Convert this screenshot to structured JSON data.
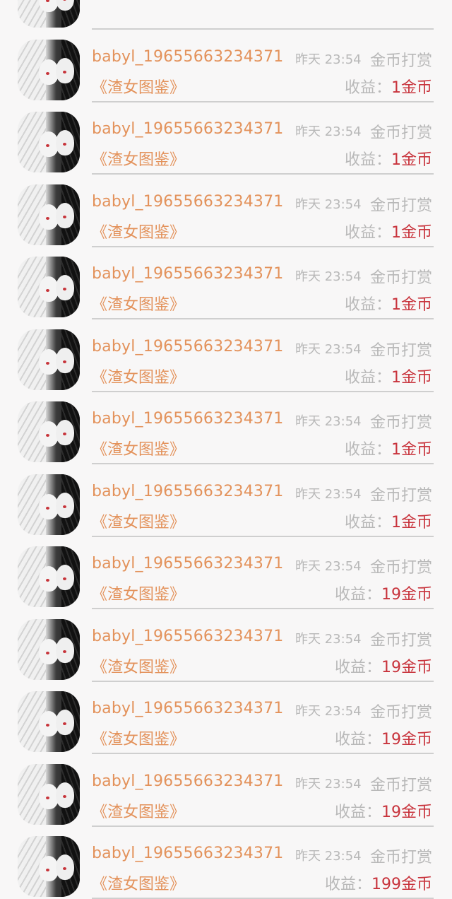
{
  "colors": {
    "accent_orange": "#e3925b",
    "muted_gray": "#b8b8b8",
    "amount_red": "#c8333c",
    "background": "#f8f7f7"
  },
  "records": [
    {
      "user": "babyl_19655663234371",
      "time": "昨天 23:54",
      "type": "金币打赏",
      "book": "《渣女图鉴》",
      "income_label": "收益：",
      "amount": "1金币"
    },
    {
      "user": "babyl_19655663234371",
      "time": "昨天 23:54",
      "type": "金币打赏",
      "book": "《渣女图鉴》",
      "income_label": "收益：",
      "amount": "1金币"
    },
    {
      "user": "babyl_19655663234371",
      "time": "昨天 23:54",
      "type": "金币打赏",
      "book": "《渣女图鉴》",
      "income_label": "收益：",
      "amount": "1金币"
    },
    {
      "user": "babyl_19655663234371",
      "time": "昨天 23:54",
      "type": "金币打赏",
      "book": "《渣女图鉴》",
      "income_label": "收益：",
      "amount": "1金币"
    },
    {
      "user": "babyl_19655663234371",
      "time": "昨天 23:54",
      "type": "金币打赏",
      "book": "《渣女图鉴》",
      "income_label": "收益：",
      "amount": "1金币"
    },
    {
      "user": "babyl_19655663234371",
      "time": "昨天 23:54",
      "type": "金币打赏",
      "book": "《渣女图鉴》",
      "income_label": "收益：",
      "amount": "1金币"
    },
    {
      "user": "babyl_19655663234371",
      "time": "昨天 23:54",
      "type": "金币打赏",
      "book": "《渣女图鉴》",
      "income_label": "收益：",
      "amount": "1金币"
    },
    {
      "user": "babyl_19655663234371",
      "time": "昨天 23:54",
      "type": "金币打赏",
      "book": "《渣女图鉴》",
      "income_label": "收益：",
      "amount": "19金币"
    },
    {
      "user": "babyl_19655663234371",
      "time": "昨天 23:54",
      "type": "金币打赏",
      "book": "《渣女图鉴》",
      "income_label": "收益：",
      "amount": "19金币"
    },
    {
      "user": "babyl_19655663234371",
      "time": "昨天 23:54",
      "type": "金币打赏",
      "book": "《渣女图鉴》",
      "income_label": "收益：",
      "amount": "19金币"
    },
    {
      "user": "babyl_19655663234371",
      "time": "昨天 23:54",
      "type": "金币打赏",
      "book": "《渣女图鉴》",
      "income_label": "收益：",
      "amount": "19金币"
    },
    {
      "user": "babyl_19655663234371",
      "time": "昨天 23:54",
      "type": "金币打赏",
      "book": "《渣女图鉴》",
      "income_label": "收益：",
      "amount": "199金币"
    }
  ]
}
